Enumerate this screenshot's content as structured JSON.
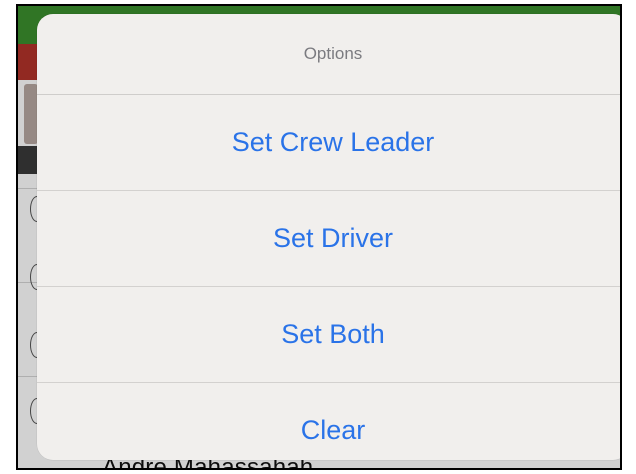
{
  "background": {
    "partial_name": "Andre Mahassahah"
  },
  "sheet": {
    "title": "Options",
    "actions": [
      {
        "label": "Set Crew Leader"
      },
      {
        "label": "Set Driver"
      },
      {
        "label": "Set Both"
      },
      {
        "label": "Clear"
      }
    ]
  },
  "colors": {
    "action_text": "#2a73e8",
    "title_text": "#7b7b80",
    "sheet_bg": "#f1efed",
    "app_header_green": "#3b8f2e",
    "app_header_red": "#b3322a"
  }
}
